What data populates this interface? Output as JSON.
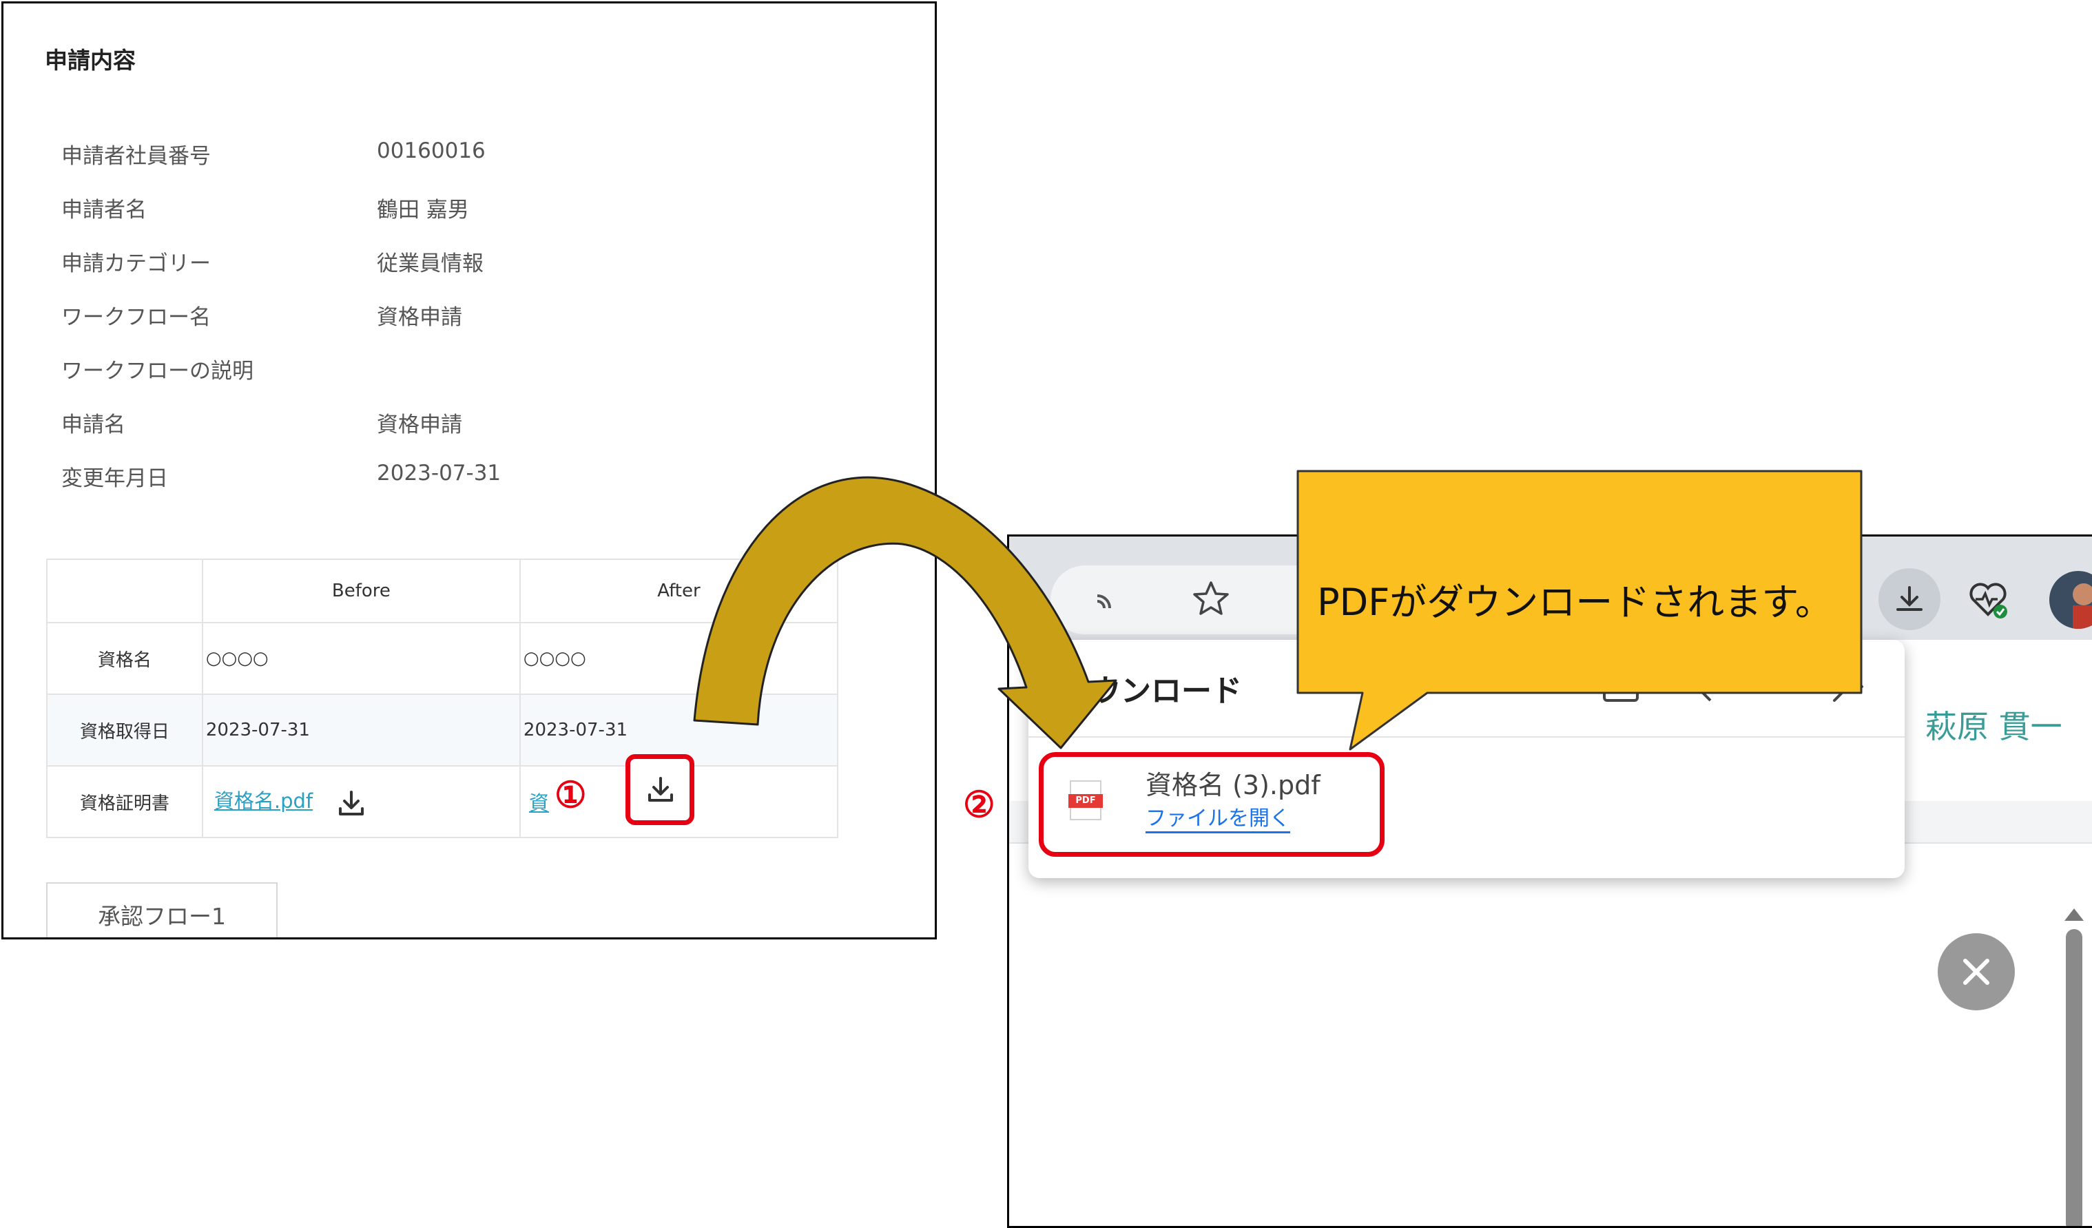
{
  "left": {
    "section_title": "申請内容",
    "info_rows": [
      {
        "label": "申請者社員番号",
        "value": "00160016"
      },
      {
        "label": "申請者名",
        "value": "鶴田 嘉男"
      },
      {
        "label": "申請カテゴリー",
        "value": "従業員情報"
      },
      {
        "label": "ワークフロー名",
        "value": "資格申請"
      },
      {
        "label": "ワークフローの説明",
        "value": ""
      },
      {
        "label": "申請名",
        "value": "資格申請"
      },
      {
        "label": "変更年月日",
        "value": "2023-07-31"
      }
    ],
    "table": {
      "headers": [
        "",
        "Before",
        "After"
      ],
      "rows": [
        {
          "label": "資格名",
          "before": "○○○○",
          "after": "○○○○"
        },
        {
          "label": "資格取得日",
          "before": "2023-07-31",
          "after": "2023-07-31"
        },
        {
          "label": "資格証明書",
          "before": "資格名.pdf",
          "after": "資"
        }
      ]
    },
    "tab_label": "承認フロー1"
  },
  "markers": {
    "step1": "①",
    "step2": "②"
  },
  "browser": {
    "downloads_title": "ウンロード",
    "file_name": "資格名 (3).pdf",
    "file_open_label": "ファイルを開く",
    "pdf_badge": "PDF",
    "user_name": "萩原 貫一"
  },
  "callout": {
    "text": "PDFがダウンロードされます。"
  },
  "colors": {
    "highlight_red": "#e60012",
    "arrow_gold": "#c9a015",
    "callout_yellow": "#fbc020",
    "link": "#2aa0c4",
    "user_name_teal": "#3a9c97"
  }
}
